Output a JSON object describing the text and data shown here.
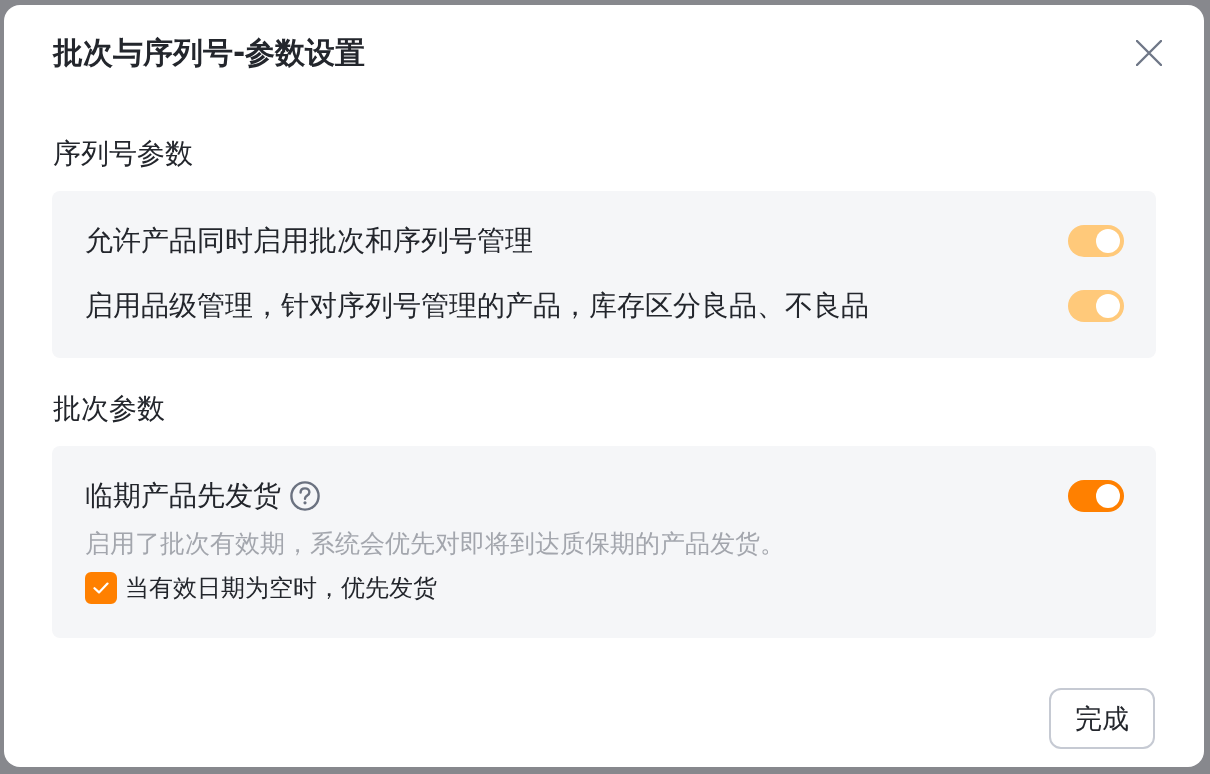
{
  "dialog": {
    "title": "批次与序列号-参数设置"
  },
  "sections": [
    {
      "title": "序列号参数",
      "settings": [
        {
          "label": "允许产品同时启用批次和序列号管理",
          "on": true,
          "disabled": true
        },
        {
          "label": "启用品级管理，针对序列号管理的产品，库存区分良品、不良品",
          "on": true,
          "disabled": true
        }
      ]
    },
    {
      "title": "批次参数",
      "settings": [
        {
          "label": "临期产品先发货",
          "help": true,
          "on": true,
          "disabled": false,
          "description": "启用了批次有效期，系统会优先对即将到达质保期的产品发货。",
          "option": {
            "label": "当有效日期为空时，优先发货",
            "checked": true
          }
        }
      ]
    }
  ],
  "buttons": [
    {
      "label": "完成"
    }
  ]
}
